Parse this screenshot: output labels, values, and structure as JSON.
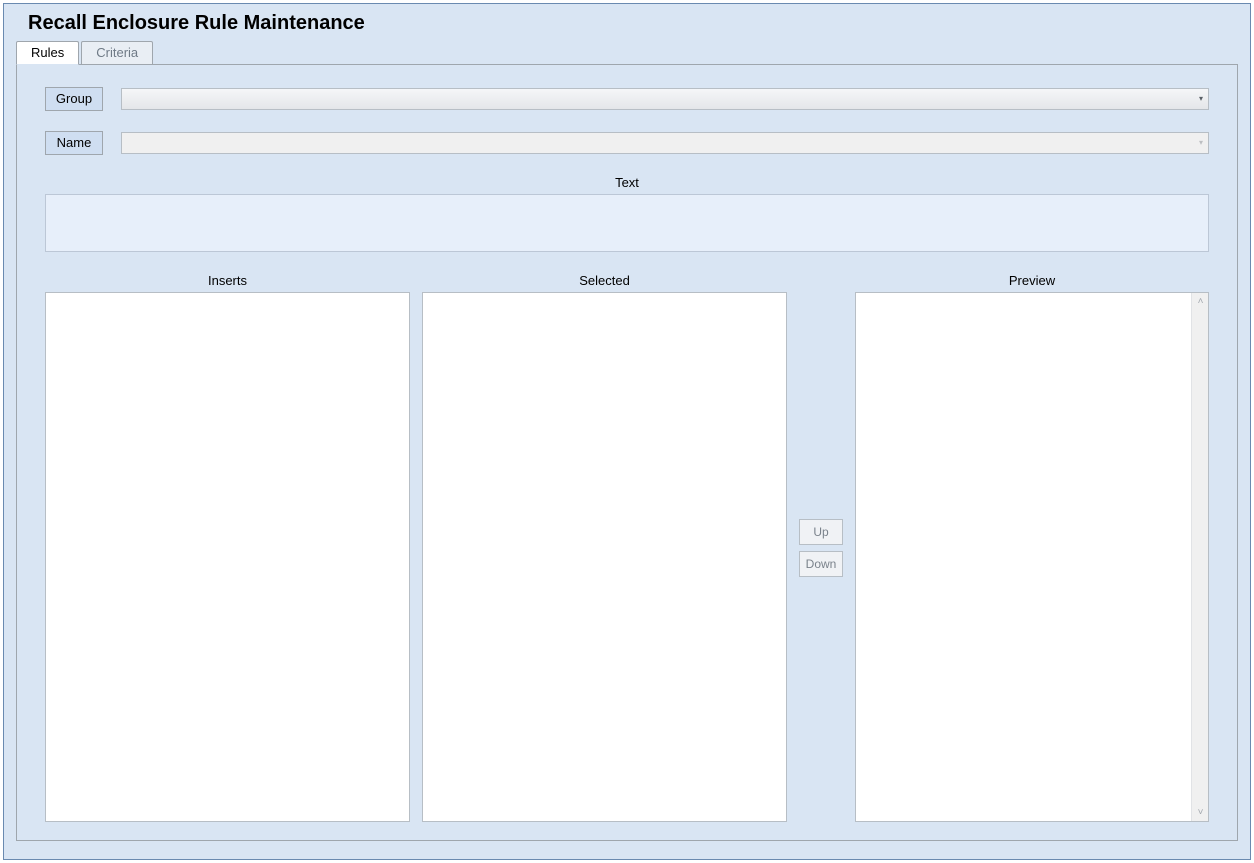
{
  "header": {
    "title": "Recall Enclosure Rule Maintenance"
  },
  "tabs": {
    "rules_label": "Rules",
    "criteria_label": "Criteria",
    "active": "rules"
  },
  "form": {
    "group_button_label": "Group",
    "group_value": "",
    "name_button_label": "Name",
    "name_value": "",
    "text_section_label": "Text",
    "text_value": ""
  },
  "columns": {
    "inserts_label": "Inserts",
    "selected_label": "Selected",
    "preview_label": "Preview"
  },
  "buttons": {
    "up_label": "Up",
    "down_label": "Down"
  },
  "lists": {
    "inserts_items": [],
    "selected_items": [],
    "preview_content": ""
  }
}
